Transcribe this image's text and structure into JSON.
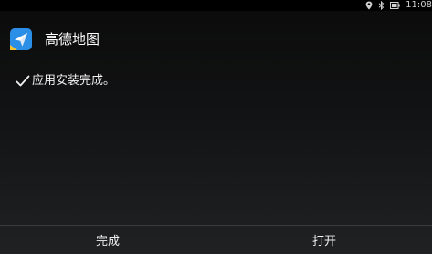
{
  "status_bar": {
    "time": "11:08",
    "icons": [
      "location-icon",
      "bluetooth-icon",
      "battery-icon"
    ]
  },
  "app": {
    "name": "高德地图",
    "icon": "amap-logo-icon",
    "icon_colors": {
      "background": "#2b8fe8",
      "arrow": "#ffffff",
      "accent": "#f6c431"
    }
  },
  "install": {
    "message": "应用安装完成。",
    "status_icon": "checkmark-icon"
  },
  "buttons": {
    "done_label": "完成",
    "open_label": "打开"
  }
}
